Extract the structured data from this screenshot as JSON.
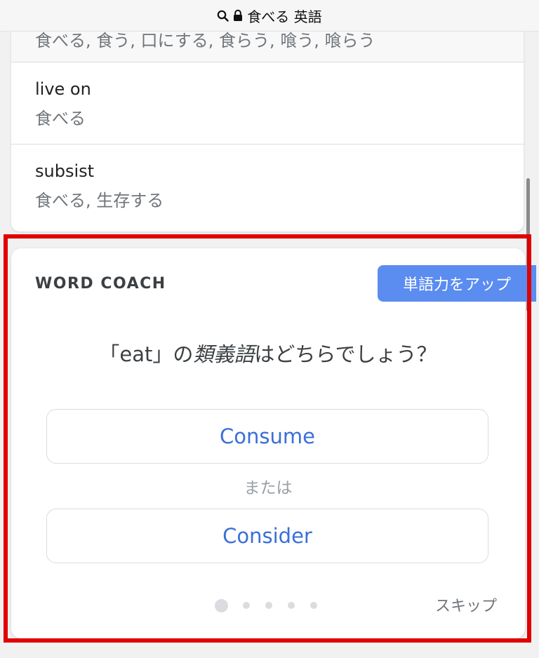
{
  "address_bar": {
    "query": "食べる 英語",
    "icons": [
      "search-icon",
      "lock-icon"
    ]
  },
  "results": {
    "cut_off_row": {
      "ja": "食べる, 食う, 口にする, 食らう, 喰う, 喰らう"
    },
    "rows": [
      {
        "en": "live on",
        "ja": "食べる"
      },
      {
        "en": "subsist",
        "ja": "食べる, 生存する"
      }
    ]
  },
  "word_coach": {
    "title": "WORD COACH",
    "upgrade_label": "単語力をアップ",
    "question_prefix": "「eat」の",
    "question_emphasis": "類義語",
    "question_suffix": "はどちらでしょう？",
    "choices": [
      "Consume",
      "Consider"
    ],
    "separator": "または",
    "skip_label": "スキップ",
    "progress": {
      "current": 1,
      "total": 5
    }
  },
  "colors": {
    "accent": "#5b8cf0",
    "choice_text": "#3a6fd8",
    "highlight": "#e00000"
  }
}
